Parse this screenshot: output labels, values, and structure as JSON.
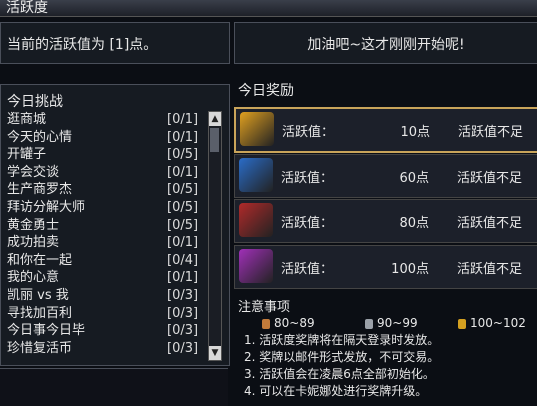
{
  "window": {
    "title": "活跃度"
  },
  "current": {
    "text": "当前的活跃值为 [1]点。"
  },
  "cheer": {
    "text": "加油吧~这才刚刚开始呢!"
  },
  "challenges": {
    "heading": "今日挑战",
    "items": [
      {
        "name": "逛商城",
        "progress": "[0/1]"
      },
      {
        "name": "今天的心情",
        "progress": "[0/1]"
      },
      {
        "name": "开罐子",
        "progress": "[0/5]"
      },
      {
        "name": "学会交谈",
        "progress": "[0/1]"
      },
      {
        "name": "生产商罗杰",
        "progress": "[0/5]"
      },
      {
        "name": "拜访分解大师",
        "progress": "[0/5]"
      },
      {
        "name": "黄金勇士",
        "progress": "[0/5]"
      },
      {
        "name": "成功拍卖",
        "progress": "[0/1]"
      },
      {
        "name": "和你在一起",
        "progress": "[0/4]"
      },
      {
        "name": "我的心意",
        "progress": "[0/1]"
      },
      {
        "name": "凯丽 vs 我",
        "progress": "[0/3]"
      },
      {
        "name": "寻找加百利",
        "progress": "[0/3]"
      },
      {
        "name": "今日事今日毕",
        "progress": "[0/3]"
      },
      {
        "name": "珍惜复活币",
        "progress": "[0/3]"
      }
    ],
    "scroll_up": "▲",
    "scroll_down": "▼"
  },
  "rewards": {
    "heading": "今日奖励",
    "items": [
      {
        "label": "活跃值：",
        "points": "10点",
        "status": "活跃值不足",
        "color": "#e0a020",
        "selected": true
      },
      {
        "label": "活跃值：",
        "points": "60点",
        "status": "活跃值不足",
        "color": "#2a6cc8",
        "selected": false
      },
      {
        "label": "活跃值：",
        "points": "80点",
        "status": "活跃值不足",
        "color": "#b02a2a",
        "selected": false
      },
      {
        "label": "活跃值：",
        "points": "100点",
        "status": "活跃值不足",
        "color": "#a030b8",
        "selected": false
      }
    ]
  },
  "notes": {
    "heading": "注意事项",
    "medals": [
      {
        "range": "80~89",
        "color": "#c27a3a"
      },
      {
        "range": "90~99",
        "color": "#9aa0a8"
      },
      {
        "range": "100~102",
        "color": "#d4a020"
      }
    ],
    "lines": [
      "1. 活跃度奖牌将在隔天登录时发放。",
      "2. 奖牌以邮件形式发放，不可交易。",
      "3. 活跃值会在凌晨6点全部初始化。",
      "4. 可以在卡妮娜处进行奖牌升级。"
    ]
  }
}
